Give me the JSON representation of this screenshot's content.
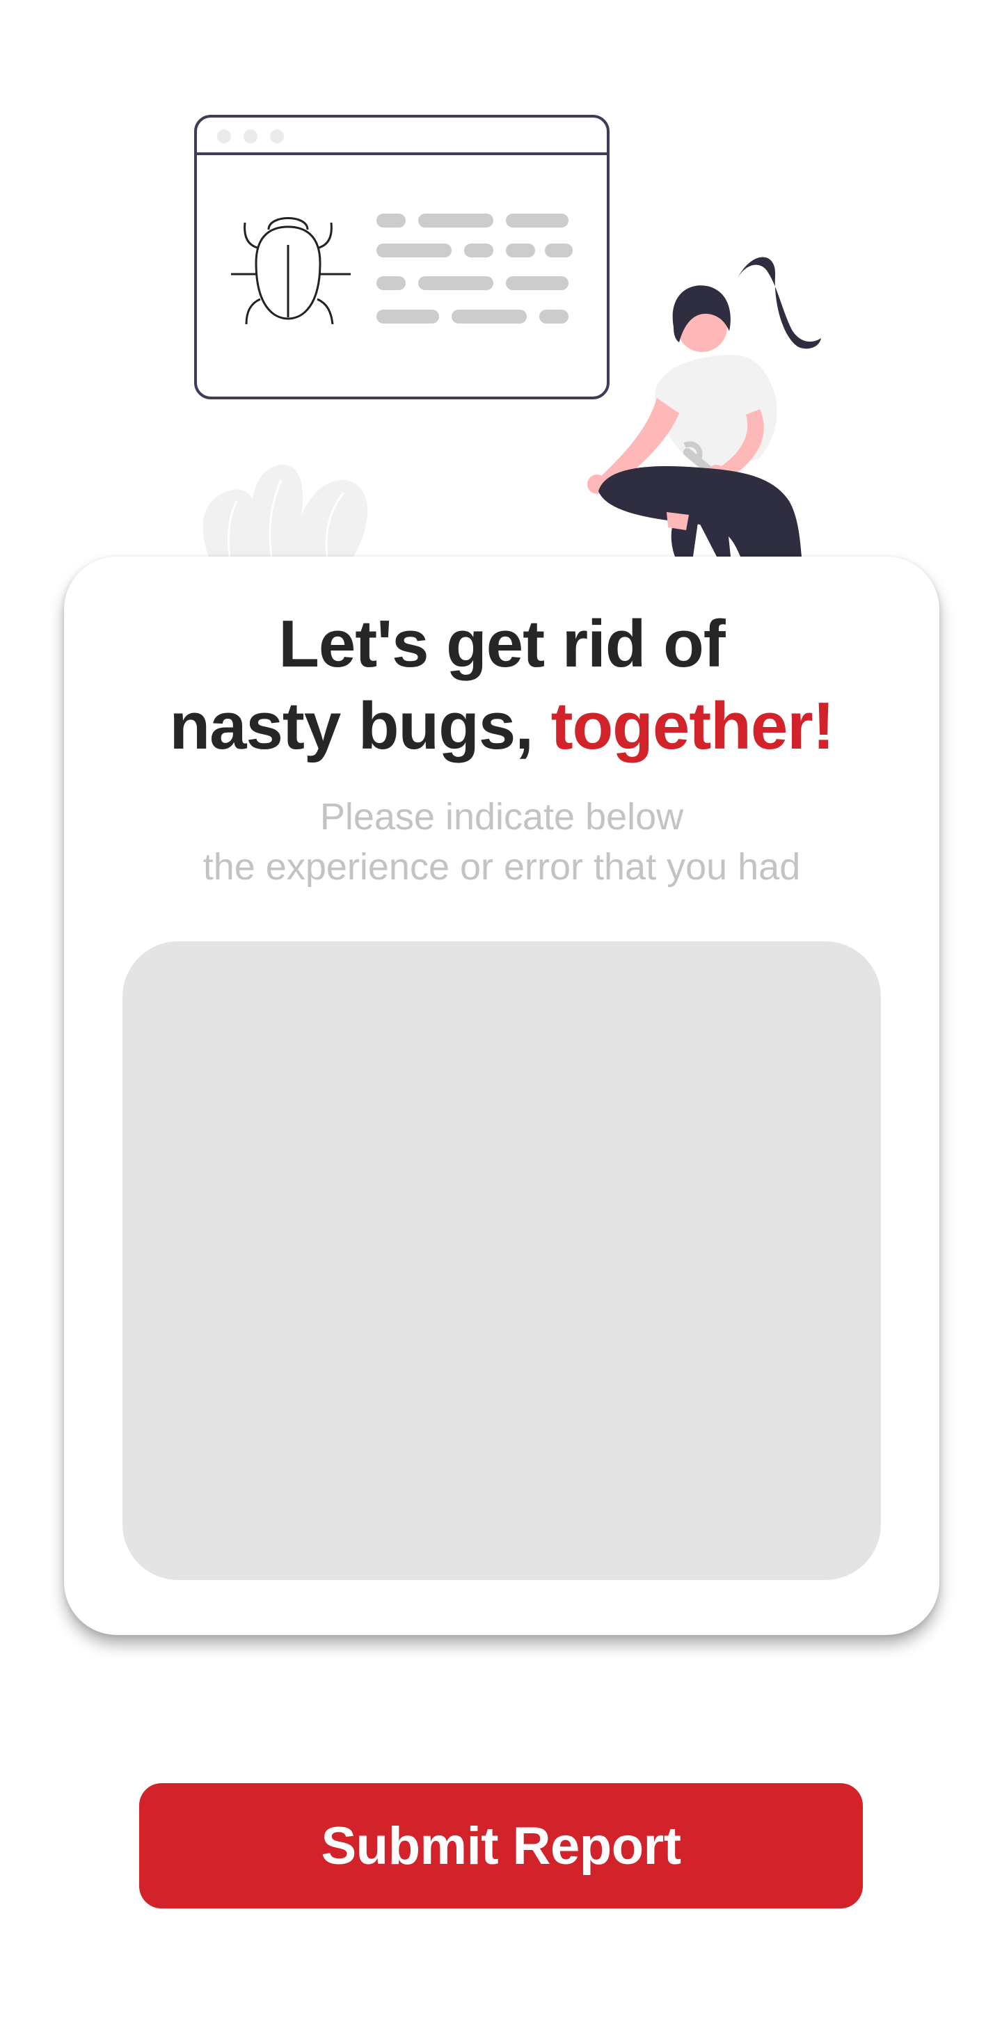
{
  "colors": {
    "accent": "#d3232a",
    "heading": "#262626",
    "subtitle": "#c3c3c3",
    "input_background": "#e4e4e4",
    "outline_dark": "#3f3d56",
    "placeholder_lines": "#cccccc"
  },
  "illustration": {
    "icons": [
      "browser-window",
      "bug-icon",
      "code-lines",
      "plant-decoration",
      "person-with-wrench"
    ]
  },
  "card": {
    "headline_line1": "Let's get rid of",
    "headline_line2_plain": "nasty bugs, ",
    "headline_line2_accent": "together!",
    "subtitle_line1": "Please indicate below",
    "subtitle_line2": "the experience or error that you had"
  },
  "report": {
    "value": "",
    "placeholder": ""
  },
  "submit": {
    "label": "Submit Report"
  }
}
